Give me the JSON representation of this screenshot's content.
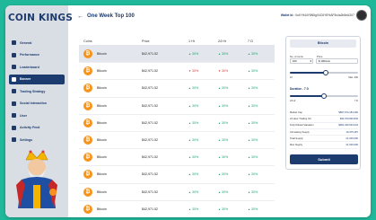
{
  "brand": {
    "logo_text": "COIN KINGS"
  },
  "sidebar": {
    "items": [
      {
        "label": "General",
        "active": false
      },
      {
        "label": "Performance",
        "active": false
      },
      {
        "label": "Leaderboard",
        "active": false
      },
      {
        "label": "Banner",
        "active": true
      },
      {
        "label": "Trading Strategy",
        "active": false
      },
      {
        "label": "Social Interaction",
        "active": false
      },
      {
        "label": "User",
        "active": false
      },
      {
        "label": "Activity Feed",
        "active": false
      },
      {
        "label": "Settings",
        "active": false
      }
    ]
  },
  "header": {
    "back_icon": "back-arrow-icon",
    "title": "One Week Top 100",
    "wallet_label": "Wallet Id :",
    "wallet_value": "0x4YH44Y8N5gX4C6Y8YtAF5v4a2h8eA3X7"
  },
  "table": {
    "columns": [
      "Coins",
      "Price",
      "1 Hr",
      "24 Hr",
      "7 D"
    ],
    "rows": [
      {
        "coin": "Bitcoin",
        "price": "$42,971.52",
        "h1": "30%",
        "h24": "30%",
        "d7": "30%",
        "h1_dir": "up",
        "h24_dir": "up",
        "d7_dir": "up"
      },
      {
        "coin": "Bitcoin",
        "price": "$42,971.52",
        "h1": "30%",
        "h24": "30%",
        "d7": "30%",
        "h1_dir": "down",
        "h24_dir": "down",
        "d7_dir": "up"
      },
      {
        "coin": "Bitcoin",
        "price": "$42,971.52",
        "h1": "30%",
        "h24": "30%",
        "d7": "30%",
        "h1_dir": "up",
        "h24_dir": "up",
        "d7_dir": "up"
      },
      {
        "coin": "Bitcoin",
        "price": "$42,971.52",
        "h1": "30%",
        "h24": "30%",
        "d7": "30%",
        "h1_dir": "up",
        "h24_dir": "up",
        "d7_dir": "up"
      },
      {
        "coin": "Bitcoin",
        "price": "$42,971.52",
        "h1": "30%",
        "h24": "30%",
        "d7": "30%",
        "h1_dir": "up",
        "h24_dir": "up",
        "d7_dir": "up"
      },
      {
        "coin": "Bitcoin",
        "price": "$42,971.52",
        "h1": "30%",
        "h24": "30%",
        "d7": "30%",
        "h1_dir": "up",
        "h24_dir": "up",
        "d7_dir": "up"
      },
      {
        "coin": "Bitcoin",
        "price": "$42,971.52",
        "h1": "30%",
        "h24": "30%",
        "d7": "30%",
        "h1_dir": "up",
        "h24_dir": "up",
        "d7_dir": "up"
      },
      {
        "coin": "Bitcoin",
        "price": "$42,971.52",
        "h1": "30%",
        "h24": "30%",
        "d7": "30%",
        "h1_dir": "up",
        "h24_dir": "up",
        "d7_dir": "up"
      },
      {
        "coin": "Bitcoin",
        "price": "$42,971.52",
        "h1": "30%",
        "h24": "30%",
        "d7": "30%",
        "h1_dir": "up",
        "h24_dir": "up",
        "d7_dir": "up"
      },
      {
        "coin": "Bitcoin",
        "price": "$42,971.52",
        "h1": "30%",
        "h24": "30%",
        "d7": "30%",
        "h1_dir": "up",
        "h24_dir": "up",
        "d7_dir": "up"
      }
    ]
  },
  "panel": {
    "title": "Bitcoin",
    "no_of_coins_label": "No. of coins",
    "price_label": "Price",
    "coins_value": "100",
    "price_value": "$ 100/coin",
    "coin_slider": {
      "value": 0.52,
      "min_label": "10",
      "max_label": "Max. 400"
    },
    "duration_label": "Duration - 7 D",
    "duration_slider": {
      "value": 0.5,
      "min_label": "24 Hr",
      "max_label": "7 D"
    },
    "stats": [
      {
        "label": "Market Cap",
        "value": "$807,674,184,290"
      },
      {
        "label": "24 Hour Trading Vol",
        "value": "$30,703,820,846"
      },
      {
        "label": "Fully Diluted Valuation",
        "value": "$901,430,533,044"
      },
      {
        "label": "Circulating Supply",
        "value": "19,375,487"
      },
      {
        "label": "Total Supply",
        "value": "21,000,000"
      },
      {
        "label": "Max Supply",
        "value": "21,000,000"
      }
    ],
    "submit_label": "Submit"
  },
  "colors": {
    "accent": "#1c3b6e",
    "background": "#1fb89a",
    "up": "#1aa36b",
    "down": "#d63a3a",
    "coin": "#f7931a"
  }
}
